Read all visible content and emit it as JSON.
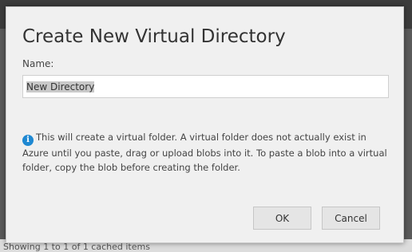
{
  "background": {
    "status_text": "Showing 1 to 1 of 1 cached items"
  },
  "dialog": {
    "title": "Create New Virtual Directory",
    "name_label": "Name:",
    "name_value": "New Directory",
    "info_icon": "info-icon",
    "info_text": "This will create a virtual folder. A virtual folder does not actually exist in Azure until you paste, drag or upload blobs into it. To paste a blob into a virtual folder, copy the blob before creating the folder.",
    "ok_label": "OK",
    "cancel_label": "Cancel"
  },
  "colors": {
    "info_icon": "#1e88d2",
    "dialog_bg": "#f0f0f0"
  }
}
